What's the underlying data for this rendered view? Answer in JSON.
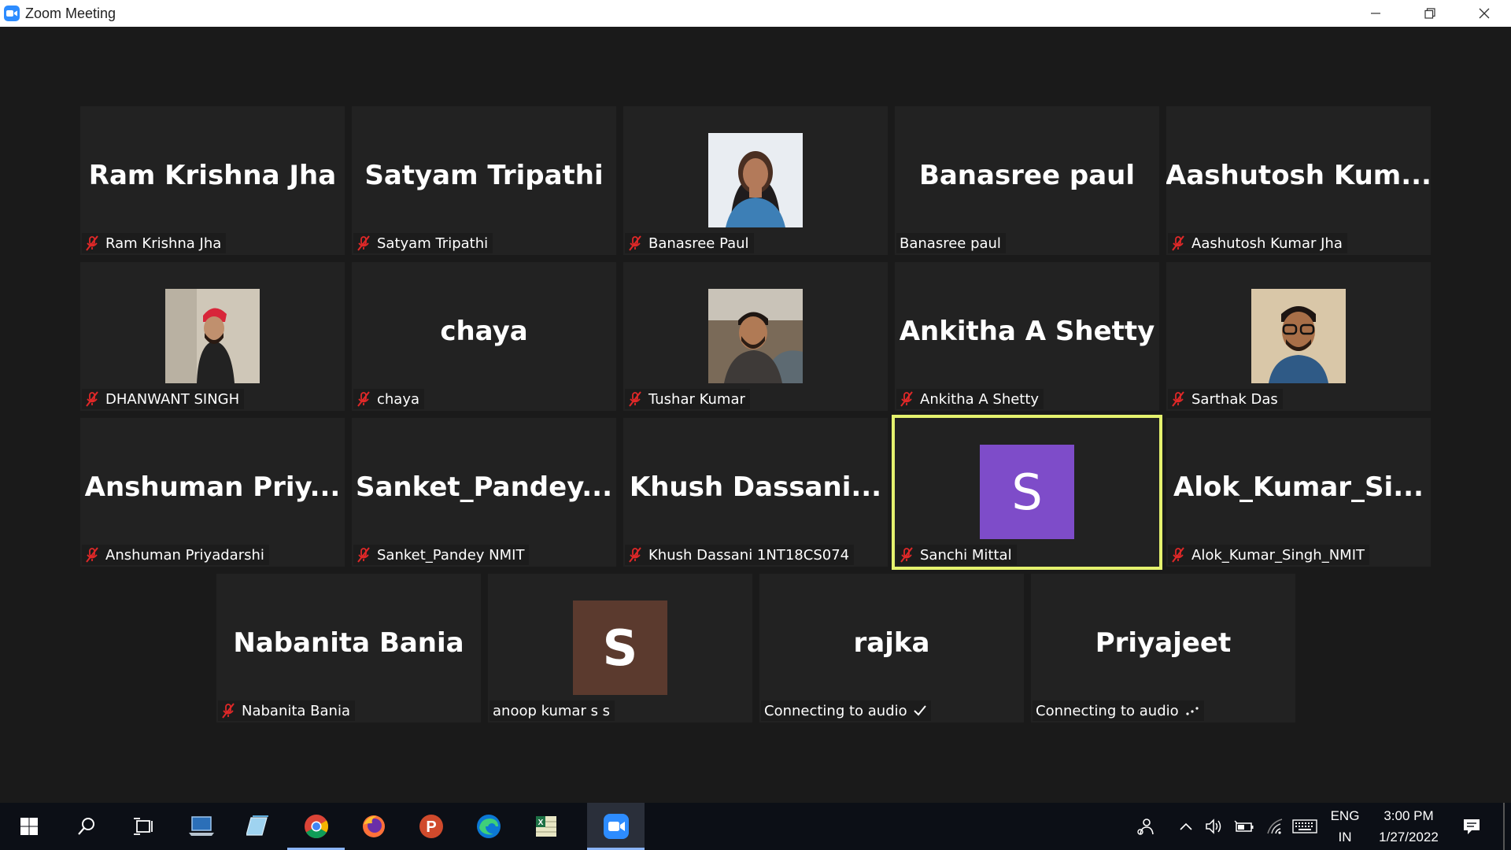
{
  "window": {
    "title": "Zoom Meeting",
    "controls": [
      "minimize",
      "restore",
      "close"
    ]
  },
  "participants": [
    {
      "display": "Ram Krishna Jha",
      "label": "Ram Krishna Jha",
      "muted": true,
      "type": "name"
    },
    {
      "display": "Satyam Tripathi",
      "label": "Satyam Tripathi",
      "muted": true,
      "type": "name"
    },
    {
      "display": "",
      "label": "Banasree Paul",
      "muted": true,
      "type": "photo",
      "photo": "woman-portrait"
    },
    {
      "display": "Banasree paul",
      "label": "Banasree paul",
      "muted": false,
      "type": "name"
    },
    {
      "display": "Aashutosh  Kum...",
      "label": "Aashutosh Kumar Jha",
      "muted": true,
      "type": "name"
    },
    {
      "display": "",
      "label": "DHANWANT SINGH",
      "muted": true,
      "type": "photo",
      "photo": "man-red-turban"
    },
    {
      "display": "chaya",
      "label": "chaya",
      "muted": true,
      "type": "name"
    },
    {
      "display": "",
      "label": "Tushar Kumar",
      "muted": true,
      "type": "photo",
      "photo": "man-selfie"
    },
    {
      "display": "Ankitha A Shetty",
      "label": "Ankitha A Shetty",
      "muted": true,
      "type": "name"
    },
    {
      "display": "",
      "label": "Sarthak Das",
      "muted": true,
      "type": "photo",
      "photo": "man-glasses"
    },
    {
      "display": "Anshuman  Priy...",
      "label": "Anshuman Priyadarshi",
      "muted": true,
      "type": "name"
    },
    {
      "display": "Sanket_Pandey...",
      "label": "Sanket_Pandey NMIT",
      "muted": true,
      "type": "name"
    },
    {
      "display": "Khush  Dassani...",
      "label": "Khush Dassani 1NT18CS074",
      "muted": true,
      "type": "name"
    },
    {
      "display": "S",
      "label": "Sanchi Mittal",
      "muted": true,
      "type": "letter",
      "avatar_color": "#7e4cc9",
      "active_speaker": true
    },
    {
      "display": "Alok_Kumar_Si...",
      "label": "Alok_Kumar_Singh_NMIT",
      "muted": true,
      "type": "name"
    },
    {
      "display": "Nabanita Bania",
      "label": "Nabanita Bania",
      "muted": true,
      "type": "name"
    },
    {
      "display": "S",
      "label": "anoop kumar s s",
      "muted": false,
      "type": "letter",
      "avatar_color": "#5b3a2e"
    },
    {
      "display": "rajka",
      "label": "Connecting to audio",
      "muted": false,
      "type": "name",
      "status_icon": "check-icon"
    },
    {
      "display": "Priyajeet",
      "label": "Connecting to audio",
      "muted": false,
      "type": "name",
      "status_icon": "dots-icon"
    }
  ],
  "colors": {
    "active_speaker_border": "#e5f26e",
    "mute_icon": "#e02828",
    "tile_bg": "#222222",
    "meeting_bg": "#1a1a1a"
  },
  "taskbar": {
    "apps": [
      "windows-start-icon",
      "search-icon",
      "task-view-icon",
      "laptop-icon",
      "notepad-icon",
      "chrome-icon",
      "firefox-icon",
      "powerpoint-icon",
      "edge-icon",
      "excel-icon",
      "zoom-icon"
    ],
    "active_app": "zoom-icon",
    "language": "ENG",
    "region": "IN",
    "time": "3:00 PM",
    "date": "1/27/2022"
  }
}
